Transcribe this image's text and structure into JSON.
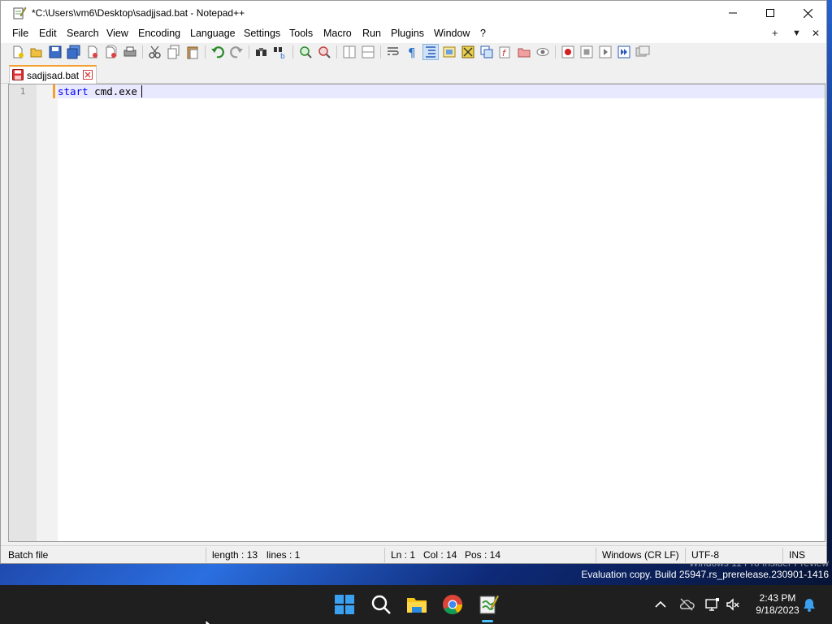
{
  "window": {
    "title": "*C:\\Users\\vm6\\Desktop\\sadjjsad.bat - Notepad++"
  },
  "menu": {
    "items": [
      "File",
      "Edit",
      "Search",
      "View",
      "Encoding",
      "Language",
      "Settings",
      "Tools",
      "Macro",
      "Run",
      "Plugins",
      "Window",
      "?"
    ],
    "right": [
      "+",
      "▼",
      "✕"
    ]
  },
  "toolbar": {
    "icons": [
      "new-file-icon",
      "open-file-icon",
      "save-icon",
      "save-all-icon",
      "close-icon",
      "close-all-icon",
      "print-icon",
      "cut-icon",
      "copy-icon",
      "paste-icon",
      "undo-icon",
      "redo-icon",
      "find-icon",
      "replace-icon",
      "zoom-in-icon",
      "zoom-out-icon",
      "sync-vertical-icon",
      "sync-horizontal-icon",
      "word-wrap-icon",
      "show-all-chars-icon",
      "indent-guide-icon",
      "user-lang-icon",
      "doc-map-icon",
      "function-list-icon",
      "folder-workspace-icon",
      "doc-list-icon",
      "monitoring-icon",
      "record-macro-icon",
      "stop-macro-icon",
      "play-macro-icon",
      "run-macro-multiple-icon",
      "save-macro-icon"
    ]
  },
  "tab": {
    "label": "sadjjsad.bat"
  },
  "editor": {
    "line_number": "1",
    "keyword": "start",
    "rest": " cmd.exe"
  },
  "status": {
    "file_type": "Batch file",
    "length": "length : 13",
    "lines": "lines : 1",
    "ln": "Ln : 1",
    "col": "Col : 14",
    "pos": "Pos : 14",
    "eol": "Windows (CR LF)",
    "encoding": "UTF-8",
    "mode": "INS"
  },
  "desktop": {
    "watermark_line1": "Windows 11 Pro Insider Preview",
    "watermark_line2": "Evaluation copy. Build 25947.rs_prerelease.230901-1416"
  },
  "taskbar": {
    "time": "2:43 PM",
    "date": "9/18/2023"
  },
  "colors": {
    "accent_tab": "#f5a030",
    "keyword": "#0000ff",
    "current_line": "#e8e8ff",
    "taskbar_indicator": "#4cc2ff"
  }
}
